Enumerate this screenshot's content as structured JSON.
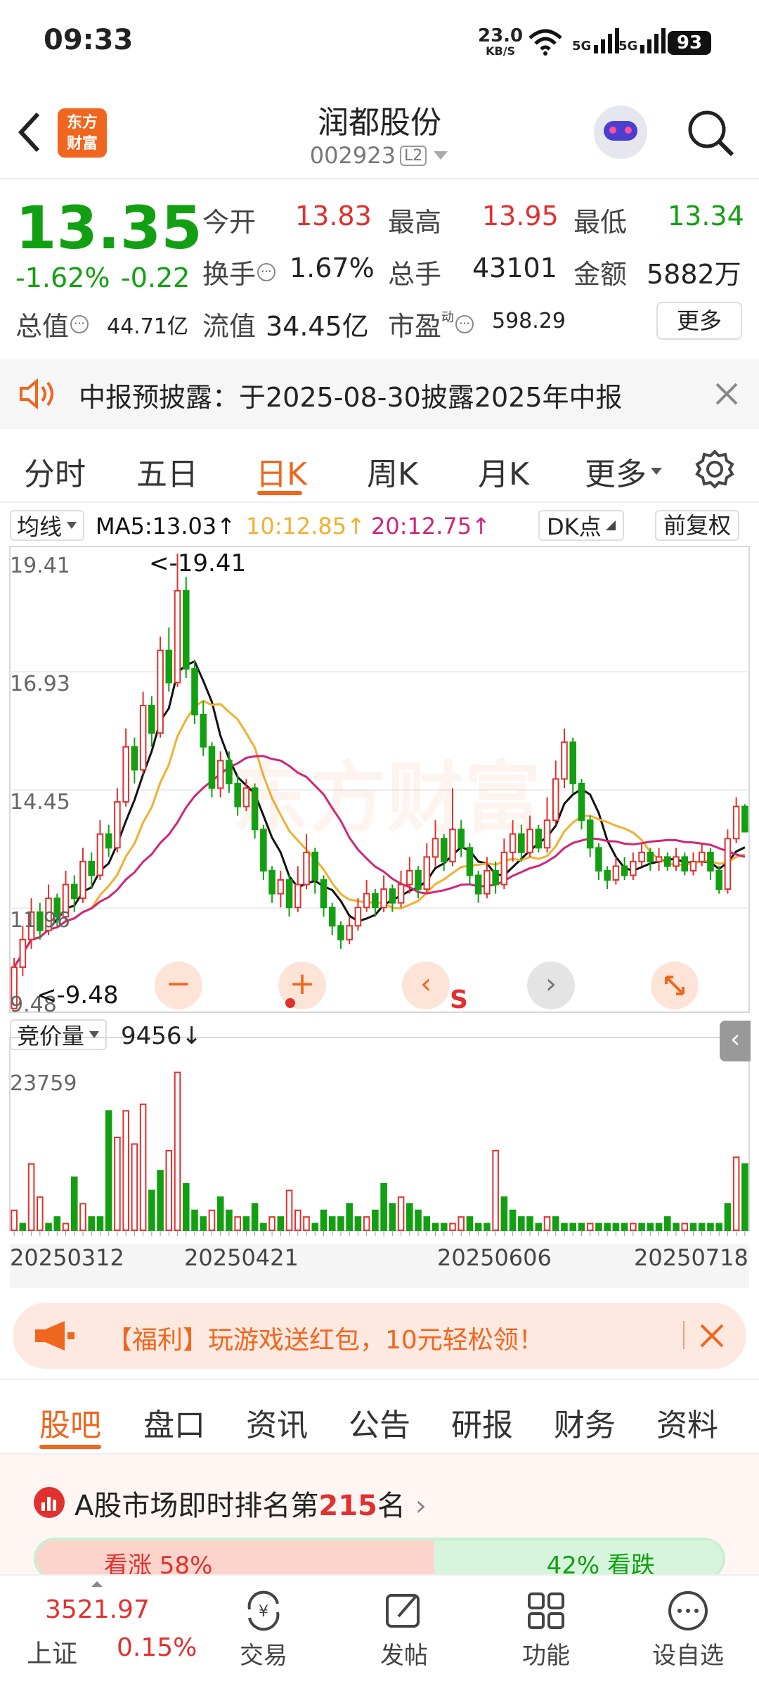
{
  "status_bar": {
    "time": "09:33",
    "net_speed_value": "23.0",
    "net_speed_unit": "KB/S",
    "signal1": "5G",
    "signal2": "5G",
    "battery": "93"
  },
  "header": {
    "stock_name": "润都股份",
    "stock_code": "002923",
    "level_badge": "L2",
    "logo_line1": "东方",
    "logo_line2": "财富"
  },
  "quote": {
    "price": "13.35",
    "change_pct": "-1.62%",
    "change": "-0.22",
    "open_label": "今开",
    "open": "13.83",
    "high_label": "最高",
    "high": "13.95",
    "low_label": "最低",
    "low": "13.34",
    "turnover_label": "换手",
    "turnover": "1.67%",
    "volume_label": "总手",
    "volume": "43101",
    "amount_label": "金额",
    "amount": "5882万",
    "mcap_label": "总值",
    "mcap": "44.71亿",
    "float_label": "流值",
    "float_mcap": "34.45亿",
    "pe_label": "市盈",
    "pe_sup": "动",
    "pe": "598.29",
    "more_button": "更多"
  },
  "notice": {
    "text": "中报预披露：于2025-08-30披露2025年中报"
  },
  "tabs": {
    "items": [
      "分时",
      "五日",
      "日K",
      "周K",
      "月K",
      "更多"
    ],
    "active": 2
  },
  "indicator_bar": {
    "selector": "均线",
    "ma5": "MA5:13.03↑",
    "ma10": "10:12.85↑",
    "ma20": "20:12.75↑",
    "dk_button": "DK点",
    "fq_button": "前复权"
  },
  "price_axis": {
    "labels": [
      "19.41",
      "16.93",
      "14.45",
      "11.96",
      "9.48"
    ],
    "max_marker": "<-19.41",
    "min_marker": "<-9.48",
    "signal": "S"
  },
  "volume_bar": {
    "selector": "竞价量",
    "value": "9456↓",
    "axis_max": "23759"
  },
  "dates": [
    "20250312",
    "20250421",
    "20250606",
    "20250718"
  ],
  "colors": {
    "up": "#e0312f",
    "down": "#12a012",
    "ma5": "#111111",
    "ma10": "#f0b030",
    "ma20": "#d0257a",
    "accent": "#f0661e"
  },
  "chart_data": {
    "type": "candlestick",
    "ylim": [
      9.48,
      19.41
    ],
    "candles": [
      [
        9.5,
        10.4,
        9.48,
        10.6
      ],
      [
        10.4,
        11.0,
        10.2,
        11.3
      ],
      [
        11.0,
        11.6,
        10.8,
        11.9
      ],
      [
        11.6,
        11.2,
        11.0,
        11.8
      ],
      [
        11.2,
        11.9,
        11.1,
        12.2
      ],
      [
        11.9,
        11.5,
        11.3,
        12.0
      ],
      [
        11.5,
        12.2,
        11.4,
        12.5
      ],
      [
        12.2,
        11.9,
        11.6,
        12.4
      ],
      [
        11.9,
        12.7,
        11.8,
        13.0
      ],
      [
        12.7,
        12.4,
        12.1,
        12.9
      ],
      [
        12.4,
        13.3,
        12.3,
        13.6
      ],
      [
        13.3,
        13.0,
        12.8,
        13.5
      ],
      [
        13.0,
        14.0,
        12.9,
        14.3
      ],
      [
        14.0,
        15.2,
        13.9,
        15.6
      ],
      [
        15.2,
        14.7,
        14.4,
        15.4
      ],
      [
        14.7,
        16.1,
        14.6,
        16.4
      ],
      [
        16.1,
        15.5,
        15.2,
        16.3
      ],
      [
        15.5,
        17.3,
        15.4,
        17.6
      ],
      [
        17.3,
        16.6,
        16.4,
        17.8
      ],
      [
        16.6,
        18.6,
        16.5,
        19.41
      ],
      [
        18.6,
        16.9,
        16.7,
        18.9
      ],
      [
        16.9,
        15.9,
        15.7,
        17.1
      ],
      [
        15.9,
        15.2,
        15.0,
        16.2
      ],
      [
        15.2,
        14.3,
        14.1,
        15.3
      ],
      [
        14.3,
        14.9,
        14.1,
        15.1
      ],
      [
        14.9,
        14.4,
        14.2,
        15.1
      ],
      [
        14.4,
        13.9,
        13.7,
        14.6
      ],
      [
        13.9,
        14.3,
        13.8,
        14.5
      ],
      [
        14.3,
        13.4,
        13.2,
        14.4
      ],
      [
        13.4,
        12.5,
        12.3,
        13.5
      ],
      [
        12.5,
        12.0,
        11.8,
        12.6
      ],
      [
        12.0,
        12.3,
        11.7,
        12.5
      ],
      [
        12.3,
        11.7,
        11.5,
        12.4
      ],
      [
        11.7,
        12.2,
        11.6,
        12.6
      ],
      [
        12.2,
        12.9,
        12.1,
        13.3
      ],
      [
        12.9,
        12.3,
        12.0,
        13.0
      ],
      [
        12.3,
        11.7,
        11.5,
        12.4
      ],
      [
        11.7,
        11.3,
        11.1,
        11.8
      ],
      [
        11.3,
        11.0,
        10.8,
        11.4
      ],
      [
        11.0,
        11.3,
        10.9,
        11.5
      ],
      [
        11.3,
        11.7,
        11.2,
        11.9
      ],
      [
        11.7,
        12.0,
        11.6,
        12.3
      ],
      [
        12.0,
        11.7,
        11.5,
        12.1
      ],
      [
        11.7,
        12.1,
        11.6,
        12.4
      ],
      [
        12.1,
        11.8,
        11.6,
        12.2
      ],
      [
        11.8,
        12.2,
        11.7,
        12.5
      ],
      [
        12.2,
        12.5,
        12.0,
        12.8
      ],
      [
        12.5,
        12.1,
        11.9,
        12.6
      ],
      [
        12.1,
        12.8,
        12.0,
        13.1
      ],
      [
        12.8,
        13.2,
        12.6,
        13.6
      ],
      [
        13.2,
        12.7,
        12.5,
        13.3
      ],
      [
        12.7,
        13.4,
        12.6,
        14.3
      ],
      [
        13.4,
        13.0,
        12.8,
        13.6
      ],
      [
        13.0,
        12.4,
        12.2,
        13.1
      ],
      [
        12.4,
        12.0,
        11.8,
        12.5
      ],
      [
        12.0,
        12.5,
        11.9,
        12.8
      ],
      [
        12.5,
        12.2,
        12.0,
        12.7
      ],
      [
        12.2,
        12.9,
        12.1,
        13.2
      ],
      [
        12.9,
        13.3,
        12.7,
        13.6
      ],
      [
        13.3,
        12.9,
        12.7,
        13.5
      ],
      [
        12.9,
        13.4,
        12.8,
        13.7
      ],
      [
        13.4,
        13.0,
        12.9,
        13.5
      ],
      [
        13.0,
        13.6,
        12.9,
        14.1
      ],
      [
        13.6,
        14.5,
        13.5,
        14.9
      ],
      [
        14.5,
        15.3,
        14.3,
        15.6
      ],
      [
        15.3,
        14.4,
        14.2,
        15.4
      ],
      [
        14.4,
        13.6,
        13.4,
        14.5
      ],
      [
        13.6,
        13.0,
        12.8,
        13.7
      ],
      [
        13.0,
        12.5,
        12.3,
        13.1
      ],
      [
        12.5,
        12.3,
        12.1,
        12.6
      ],
      [
        12.3,
        12.6,
        12.2,
        12.8
      ],
      [
        12.6,
        12.4,
        12.3,
        12.8
      ],
      [
        12.4,
        12.7,
        12.3,
        12.9
      ],
      [
        12.7,
        12.9,
        12.6,
        13.1
      ],
      [
        12.9,
        12.7,
        12.5,
        13.0
      ],
      [
        12.7,
        12.8,
        12.5,
        13.0
      ],
      [
        12.8,
        12.6,
        12.5,
        12.9
      ],
      [
        12.6,
        12.8,
        12.5,
        13.0
      ],
      [
        12.8,
        12.5,
        12.4,
        12.9
      ],
      [
        12.5,
        12.7,
        12.4,
        12.9
      ],
      [
        12.7,
        12.9,
        12.6,
        13.1
      ],
      [
        12.9,
        12.5,
        12.3,
        13.0
      ],
      [
        12.5,
        12.1,
        12.0,
        12.6
      ],
      [
        12.1,
        13.2,
        12.0,
        13.4
      ],
      [
        13.2,
        13.9,
        13.1,
        14.1
      ],
      [
        13.9,
        13.35,
        13.34,
        13.95
      ]
    ],
    "volume_max": 23759,
    "volumes": [
      [
        3,
        1
      ],
      [
        1,
        0
      ],
      [
        10,
        1
      ],
      [
        5,
        1
      ],
      [
        1,
        0
      ],
      [
        2,
        0
      ],
      [
        1,
        1
      ],
      [
        8,
        0
      ],
      [
        4,
        1
      ],
      [
        2,
        0
      ],
      [
        2,
        0
      ],
      [
        18,
        0
      ],
      [
        14,
        1
      ],
      [
        18,
        1
      ],
      [
        13,
        1
      ],
      [
        19,
        1
      ],
      [
        6,
        0
      ],
      [
        9,
        0
      ],
      [
        12,
        1
      ],
      [
        23.8,
        1
      ],
      [
        7,
        0
      ],
      [
        3,
        0
      ],
      [
        2,
        0
      ],
      [
        3,
        1
      ],
      [
        5,
        0
      ],
      [
        3,
        0
      ],
      [
        2,
        1
      ],
      [
        2,
        0
      ],
      [
        4,
        0
      ],
      [
        1,
        0
      ],
      [
        2,
        1
      ],
      [
        2,
        0
      ],
      [
        6,
        1
      ],
      [
        3,
        1
      ],
      [
        2,
        1
      ],
      [
        1,
        0
      ],
      [
        3,
        0
      ],
      [
        2,
        0
      ],
      [
        2,
        0
      ],
      [
        4,
        0
      ],
      [
        2,
        0
      ],
      [
        2,
        1
      ],
      [
        3,
        0
      ],
      [
        7,
        0
      ],
      [
        4,
        0
      ],
      [
        5,
        1
      ],
      [
        4,
        0
      ],
      [
        3,
        0
      ],
      [
        2,
        0
      ],
      [
        1,
        0
      ],
      [
        1,
        0
      ],
      [
        1,
        1
      ],
      [
        2,
        1
      ],
      [
        2,
        0
      ],
      [
        1,
        0
      ],
      [
        1,
        0
      ],
      [
        12,
        1
      ],
      [
        5,
        0
      ],
      [
        3,
        0
      ],
      [
        2,
        0
      ],
      [
        2,
        0
      ],
      [
        1,
        0
      ],
      [
        2,
        1
      ],
      [
        2,
        0
      ],
      [
        1,
        0
      ],
      [
        1,
        0
      ],
      [
        1,
        0
      ],
      [
        1,
        1
      ],
      [
        1,
        0
      ],
      [
        1,
        0
      ],
      [
        1,
        0
      ],
      [
        1,
        0
      ],
      [
        1,
        1
      ],
      [
        1,
        0
      ],
      [
        1,
        0
      ],
      [
        1,
        0
      ],
      [
        2,
        0
      ],
      [
        1,
        0
      ],
      [
        1,
        1
      ],
      [
        1,
        0
      ],
      [
        1,
        0
      ],
      [
        1,
        0
      ],
      [
        1,
        0
      ],
      [
        4,
        0
      ],
      [
        11,
        1
      ],
      [
        10,
        0
      ]
    ]
  },
  "promo": {
    "text": "【福利】玩游戏送红包，10元轻松领！"
  },
  "bottom_tabs": {
    "items": [
      "股吧",
      "盘口",
      "资讯",
      "公告",
      "研报",
      "财务",
      "资料"
    ],
    "active": 0
  },
  "ranking": {
    "prefix": "A股市场即时排名第",
    "rank": "215",
    "suffix": "名",
    "bull": "看涨 58%",
    "bear": "42% 看跌"
  },
  "bottom_nav": {
    "index_value": "3521.97",
    "index_name": "上证",
    "index_change": "0.15%",
    "trade": "交易",
    "post": "发帖",
    "functions": "功能",
    "watchlist": "设自选"
  }
}
